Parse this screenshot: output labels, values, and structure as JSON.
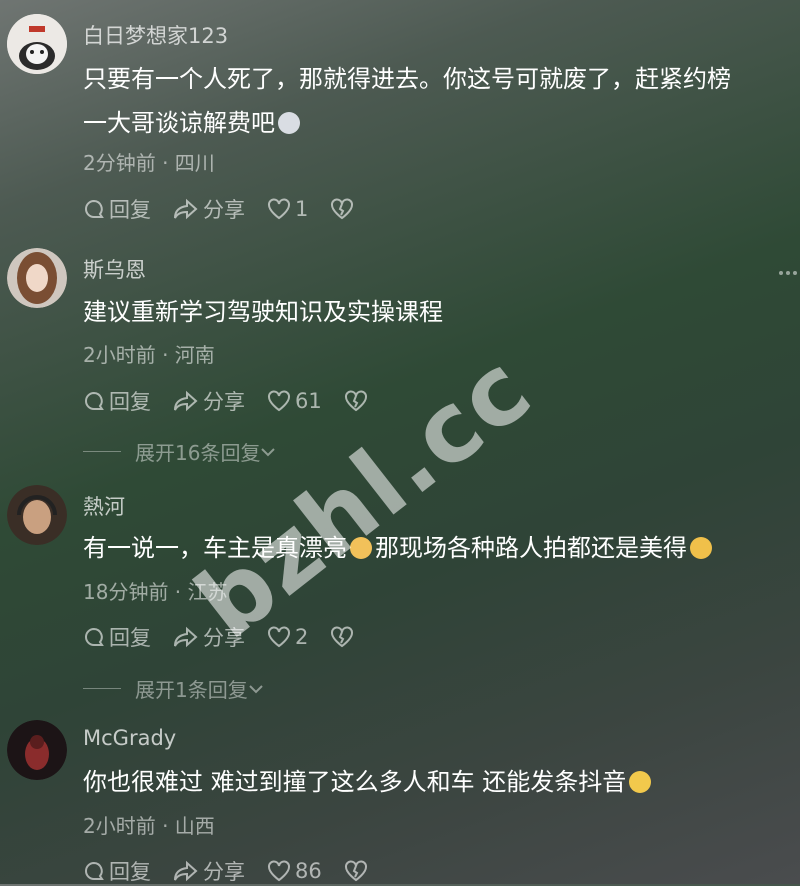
{
  "comments": [
    {
      "username": "白日梦想家123",
      "text_line1": "只要有一个人死了，那就得进去。你这号可就废了，赶紧约榜",
      "text_line2": "一大哥谈谅解费吧",
      "meta": "2分钟前 · 四川",
      "reply_label": "回复",
      "share_label": "分享",
      "likes": "1",
      "avatar_icon": "cat-avatar"
    },
    {
      "username": "斯乌恩",
      "text_line1": "建议重新学习驾驶知识及实操课程",
      "meta": "2小时前 · 河南",
      "reply_label": "回复",
      "share_label": "分享",
      "likes": "61",
      "expand_label": "展开16条回复",
      "avatar_icon": "woman-avatar"
    },
    {
      "username": "熱河",
      "text_line1a": "有一说一，车主是真漂亮",
      "text_line1b": "那现场各种路人拍都还是美得",
      "meta": "18分钟前 · 江苏",
      "reply_label": "回复",
      "share_label": "分享",
      "likes": "2",
      "expand_label": "展开1条回复",
      "avatar_icon": "headphones-avatar"
    },
    {
      "username": "McGrady",
      "text_line1": "你也很难过 难过到撞了这么多人和车 还能发条抖音",
      "meta": "2小时前 · 山西",
      "reply_label": "回复",
      "share_label": "分享",
      "likes": "86",
      "avatar_icon": "red-avatar"
    }
  ],
  "watermark": "bzhl.cc",
  "colors": {
    "background": "#2f4a36",
    "text": "#ffffff",
    "meta": "#9aa59e"
  }
}
